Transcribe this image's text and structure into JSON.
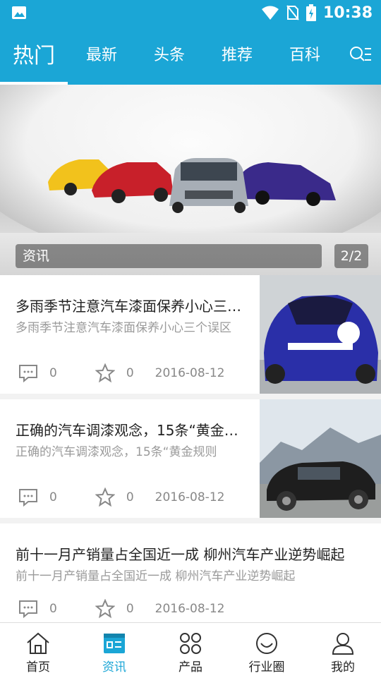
{
  "status_bar": {
    "time": "10:38"
  },
  "top_nav": {
    "tabs": [
      "热门",
      "最新",
      "头条",
      "推荐",
      "百科"
    ],
    "active_index": 0
  },
  "banner": {
    "caption": "资讯",
    "counter": "2/2"
  },
  "news": [
    {
      "title": "多雨季节注意汽车漆面保养小心三…",
      "summary": "多雨季节注意汽车漆面保养小心三个误区",
      "comments": "0",
      "likes": "0",
      "date": "2016-08-12"
    },
    {
      "title": "正确的汽车调漆观念，15条“黄金…",
      "summary": "正确的汽车调漆观念，15条“黄金规则",
      "comments": "0",
      "likes": "0",
      "date": "2016-08-12"
    },
    {
      "title": "前十一月产销量占全国近一成 柳州汽车产业逆势崛起",
      "summary": "前十一月产销量占全国近一成 柳州汽车产业逆势崛起",
      "comments": "0",
      "likes": "0",
      "date": "2016-08-12"
    }
  ],
  "bottom_nav": {
    "items": [
      "首页",
      "资讯",
      "产品",
      "行业圈",
      "我的"
    ],
    "active_index": 1
  },
  "colors": {
    "primary": "#1ba6d6"
  }
}
